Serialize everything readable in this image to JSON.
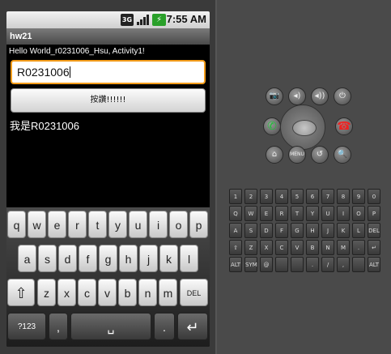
{
  "status": {
    "net": "3G",
    "battery_glyph": "⚡",
    "time": "7:55 AM"
  },
  "app": {
    "title": "hw21",
    "hello": "Hello World_r0231006_Hsu, Activity1!",
    "input_value": "R0231006",
    "button_label": "按讚!!!!!!",
    "result": "我是R0231006"
  },
  "keyboard": {
    "row1": [
      "q",
      "w",
      "e",
      "r",
      "t",
      "y",
      "u",
      "i",
      "o",
      "p"
    ],
    "row2": [
      "a",
      "s",
      "d",
      "f",
      "g",
      "h",
      "j",
      "k",
      "l"
    ],
    "row3_letters": [
      "z",
      "x",
      "c",
      "v",
      "b",
      "n",
      "m"
    ],
    "shift": "⇧",
    "del": "DEL",
    "sym": "?123",
    "comma": ",",
    "space": "␣",
    "period": ".",
    "enter": "↵"
  },
  "hw": {
    "camera": "📷",
    "vol_down": "◂)",
    "vol_up": "◂))",
    "power": "⏻",
    "call": "✆",
    "endcall": "☎",
    "home": "⌂",
    "menu": "MENU",
    "back": "↺",
    "search": "🔍"
  },
  "qwerty": {
    "row1": [
      "1",
      "2",
      "3",
      "4",
      "5",
      "6",
      "7",
      "8",
      "9",
      "0"
    ],
    "row2": [
      "Q",
      "W",
      "E",
      "R",
      "T",
      "Y",
      "U",
      "I",
      "O",
      "P"
    ],
    "row3": [
      "A",
      "S",
      "D",
      "F",
      "G",
      "H",
      "J",
      "K",
      "L",
      "DEL"
    ],
    "row4": [
      "⇧",
      "Z",
      "X",
      "C",
      "V",
      "B",
      "N",
      "M",
      ".",
      "↵"
    ],
    "row5": [
      "ALT",
      "SYM",
      "@",
      "",
      "",
      ".",
      "/",
      ",",
      "",
      "ALT"
    ]
  }
}
